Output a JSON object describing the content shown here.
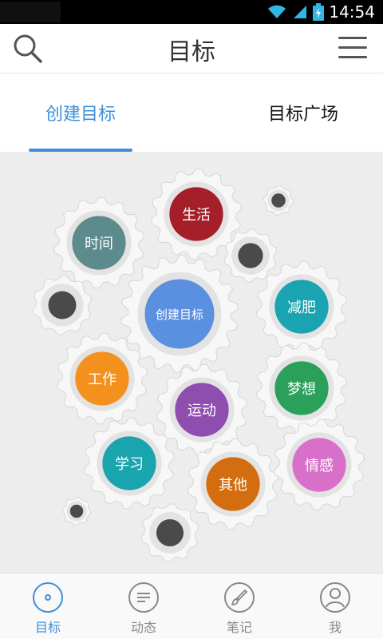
{
  "status_bar": {
    "time": "14:54"
  },
  "header": {
    "title": "目标",
    "search_icon": "search-icon",
    "menu_icon": "menu-icon"
  },
  "tabs": [
    {
      "label": "创建目标",
      "active": true
    },
    {
      "label": "目标广场",
      "active": false
    }
  ],
  "gears": [
    {
      "label": "生活",
      "color": "#a51f2a"
    },
    {
      "label": "时间",
      "color": "#5d8a8c"
    },
    {
      "label": "创建目标",
      "color": "#5b8fe0"
    },
    {
      "label": "减肥",
      "color": "#1aa3b0"
    },
    {
      "label": "工作",
      "color": "#f4911e"
    },
    {
      "label": "梦想",
      "color": "#2aa05a"
    },
    {
      "label": "运动",
      "color": "#8e4eb0"
    },
    {
      "label": "学习",
      "color": "#1aa5ae"
    },
    {
      "label": "其他",
      "color": "#d46d10"
    },
    {
      "label": "情感",
      "color": "#d86fc9"
    }
  ],
  "gear_hole_color": "#4a4a4a",
  "bottom_nav": [
    {
      "label": "目标",
      "icon": "target-icon",
      "active": true
    },
    {
      "label": "动态",
      "icon": "feed-icon",
      "active": false
    },
    {
      "label": "笔记",
      "icon": "brush-icon",
      "active": false
    },
    {
      "label": "我",
      "icon": "profile-icon",
      "active": false
    }
  ],
  "colors": {
    "accent": "#3e8fd8",
    "gear_bg": "#ededed"
  }
}
